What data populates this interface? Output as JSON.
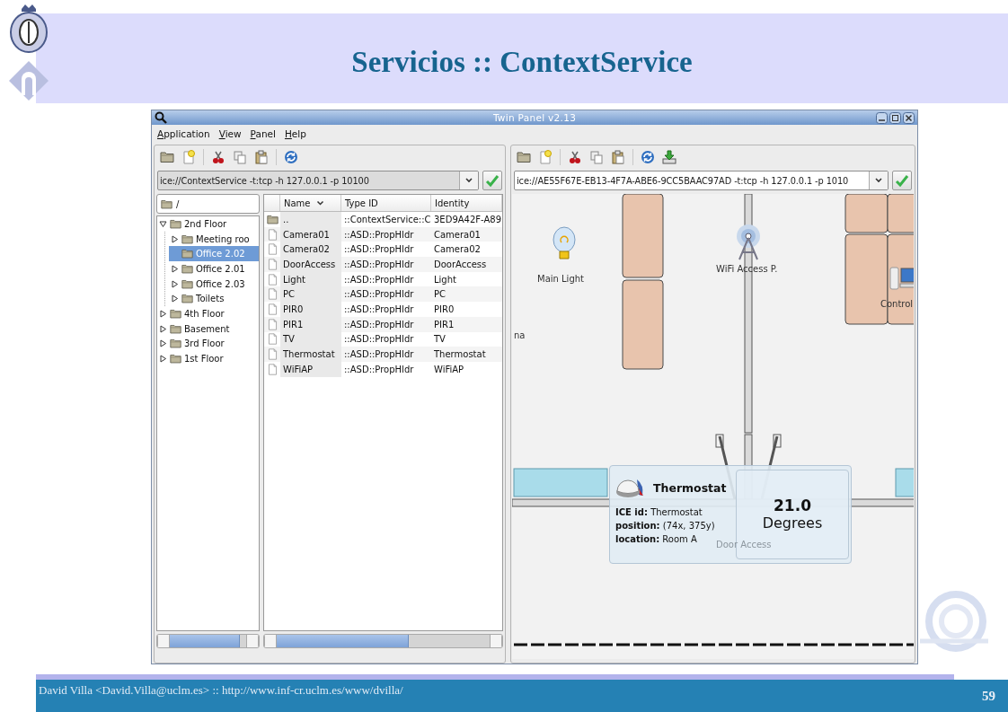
{
  "slide": {
    "title": "Servicios :: ContextService",
    "footer": "David Villa <David.Villa@uclm.es> :: http://www.inf-cr.uclm.es/www/dvilla/",
    "page_number": "59"
  },
  "window": {
    "title": "Twin Panel v2.13"
  },
  "menu": [
    "Application",
    "View",
    "Panel",
    "Help"
  ],
  "left_panel": {
    "address": {
      "value": "ice://ContextService -t:tcp -h 127.0.0.1 -p 10100",
      "disabled": true
    },
    "path": "/",
    "tree": [
      {
        "label": "2nd Floor",
        "kind": "branch",
        "expanded": true,
        "selected": false,
        "children": [
          {
            "label": "Meeting roo",
            "kind": "branch",
            "expanded": false,
            "selected": false
          },
          {
            "label": "Office 2.02",
            "kind": "leaf",
            "selected": true
          },
          {
            "label": "Office 2.01",
            "kind": "branch",
            "expanded": false,
            "selected": false
          },
          {
            "label": "Office 2.03",
            "kind": "branch",
            "expanded": false,
            "selected": false
          },
          {
            "label": "Toilets",
            "kind": "branch",
            "expanded": false,
            "selected": false
          }
        ]
      },
      {
        "label": "4th Floor",
        "kind": "branch",
        "expanded": false,
        "selected": false
      },
      {
        "label": "Basement",
        "kind": "branch",
        "expanded": false,
        "selected": false
      },
      {
        "label": "3rd Floor",
        "kind": "branch",
        "expanded": false,
        "selected": false
      },
      {
        "label": "1st Floor",
        "kind": "branch",
        "expanded": false,
        "selected": false
      }
    ],
    "table": {
      "columns": [
        "Name",
        "Type ID",
        "Identity"
      ],
      "rows": [
        {
          "kind": "folder",
          "name": "..",
          "type_id": "::ContextService::C",
          "identity": "3ED9A42F-A89"
        },
        {
          "kind": "file",
          "name": "Camera01",
          "type_id": "::ASD::PropHldr",
          "identity": "Camera01"
        },
        {
          "kind": "file",
          "name": "Camera02",
          "type_id": "::ASD::PropHldr",
          "identity": "Camera02"
        },
        {
          "kind": "file",
          "name": "DoorAccess",
          "type_id": "::ASD::PropHldr",
          "identity": "DoorAccess"
        },
        {
          "kind": "file",
          "name": "Light",
          "type_id": "::ASD::PropHldr",
          "identity": "Light"
        },
        {
          "kind": "file",
          "name": "PC",
          "type_id": "::ASD::PropHldr",
          "identity": "PC"
        },
        {
          "kind": "file",
          "name": "PIR0",
          "type_id": "::ASD::PropHldr",
          "identity": "PIR0"
        },
        {
          "kind": "file",
          "name": "PIR1",
          "type_id": "::ASD::PropHldr",
          "identity": "PIR1"
        },
        {
          "kind": "file",
          "name": "TV",
          "type_id": "::ASD::PropHldr",
          "identity": "TV"
        },
        {
          "kind": "file",
          "name": "Thermostat",
          "type_id": "::ASD::PropHldr",
          "identity": "Thermostat"
        },
        {
          "kind": "file",
          "name": "WiFiAP",
          "type_id": "::ASD::PropHldr",
          "identity": "WiFiAP"
        }
      ]
    }
  },
  "right_panel": {
    "address": {
      "value": "ice://AE55F67E-EB13-4F7A-ABE6-9CC5BAAC97AD -t:tcp -h 127.0.0.1 -p 1010",
      "disabled": false
    },
    "map": {
      "labels": [
        {
          "kind": "light",
          "text": "Main Light"
        },
        {
          "kind": "wifi",
          "text": "WiFi Access P."
        },
        {
          "kind": "computer",
          "text": "Control"
        },
        {
          "kind": "fragment",
          "text": "na"
        },
        {
          "kind": "door",
          "text": "Door Access"
        }
      ],
      "tooltip": {
        "title": "Thermostat",
        "lines": [
          "**ICE id:** Thermostat",
          "**position:** (74x, 375y)",
          "**location:** Room A"
        ],
        "reading": "21.0",
        "unit": "Degrees"
      }
    }
  }
}
